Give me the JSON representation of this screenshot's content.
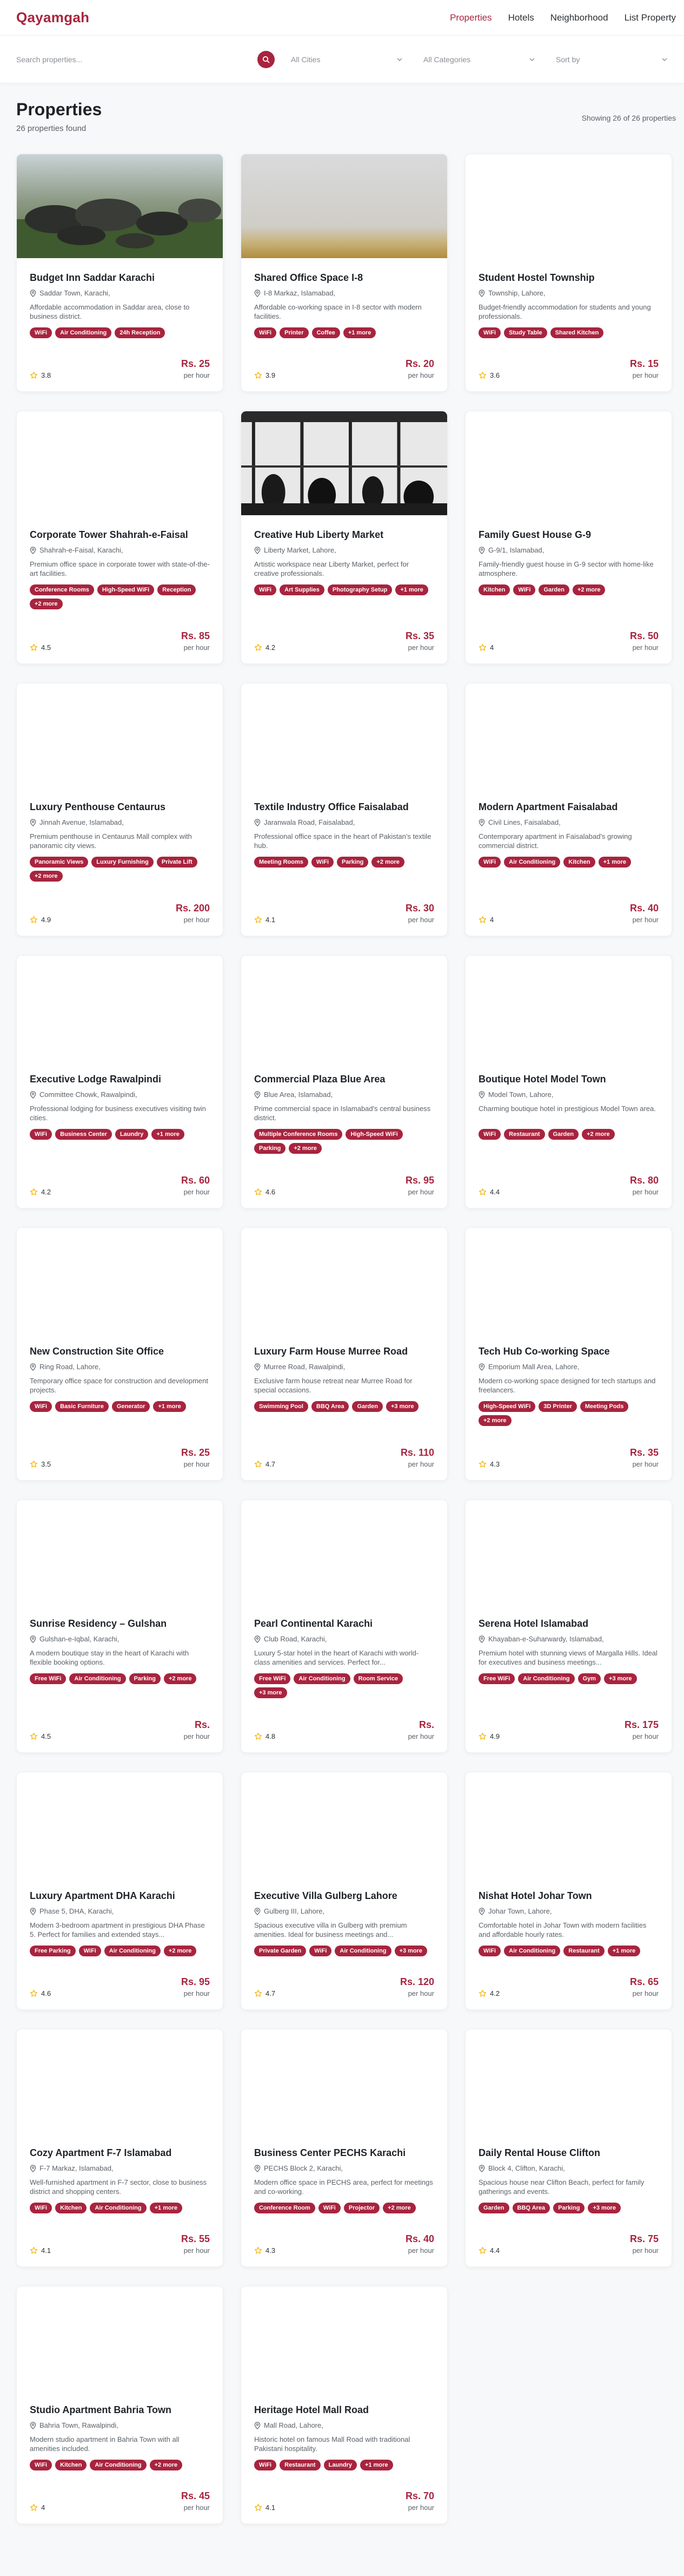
{
  "brand": "Qayamgah",
  "nav": [
    {
      "label": "Properties",
      "active": true
    },
    {
      "label": "Hotels",
      "active": false
    },
    {
      "label": "Neighborhood",
      "active": false
    },
    {
      "label": "List Property",
      "active": false
    }
  ],
  "filters": {
    "search_placeholder": "Search properties...",
    "cities": "All Cities",
    "categories": "All Categories",
    "sort": "Sort by"
  },
  "page": {
    "title": "Properties",
    "count": "26 properties found",
    "showing": "Showing 26 of 26 properties"
  },
  "colors": {
    "accent": "#a8243e",
    "star": "#f4b400"
  },
  "properties": [
    {
      "title": "Budget Inn Saddar Karachi",
      "location": "Saddar Town, Karachi,",
      "description": "Affordable accommodation in Saddar area, close to business district.",
      "tags": [
        "WiFi",
        "Air Conditioning",
        "24h Reception"
      ],
      "rating": "3.8",
      "price": "Rs. 25",
      "unit": "per hour",
      "image": "rocks"
    },
    {
      "title": "Shared Office Space I-8",
      "location": "I-8 Markaz, Islamabad,",
      "description": "Affordable co-working space in I-8 sector with modern facilities.",
      "tags": [
        "WiFi",
        "Printer",
        "Coffee",
        "+1 more"
      ],
      "rating": "3.9",
      "price": "Rs. 20",
      "unit": "per hour",
      "image": "fog"
    },
    {
      "title": "Student Hostel Township",
      "location": "Township, Lahore,",
      "description": "Budget-friendly accommodation for students and young professionals.",
      "tags": [
        "WiFi",
        "Study Table",
        "Shared Kitchen"
      ],
      "rating": "3.6",
      "price": "Rs. 15",
      "unit": "per hour",
      "image": "none"
    },
    {
      "title": "Corporate Tower Shahrah-e-Faisal",
      "location": "Shahrah-e-Faisal, Karachi,",
      "description": "Premium office space in corporate tower with state-of-the-art facilities.",
      "tags": [
        "Conference Rooms",
        "High-Speed WiFi",
        "Reception",
        "+2 more"
      ],
      "rating": "4.5",
      "price": "Rs. 85",
      "unit": "per hour",
      "image": "none"
    },
    {
      "title": "Creative Hub Liberty Market",
      "location": "Liberty Market, Lahore,",
      "description": "Artistic workspace near Liberty Market, perfect for creative professionals.",
      "tags": [
        "WiFi",
        "Art Supplies",
        "Photography Setup",
        "+1 more"
      ],
      "rating": "4.2",
      "price": "Rs. 35",
      "unit": "per hour",
      "image": "cafe"
    },
    {
      "title": "Family Guest House G-9",
      "location": "G-9/1, Islamabad,",
      "description": "Family-friendly guest house in G-9 sector with home-like atmosphere.",
      "tags": [
        "Kitchen",
        "WiFi",
        "Garden",
        "+2 more"
      ],
      "rating": "4",
      "price": "Rs. 50",
      "unit": "per hour",
      "image": "none"
    },
    {
      "title": "Luxury Penthouse Centaurus",
      "location": "Jinnah Avenue, Islamabad,",
      "description": "Premium penthouse in Centaurus Mall complex with panoramic city views.",
      "tags": [
        "Panoramic Views",
        "Luxury Furnishing",
        "Private Lift",
        "+2 more"
      ],
      "rating": "4.9",
      "price": "Rs. 200",
      "unit": "per hour",
      "image": "none"
    },
    {
      "title": "Textile Industry Office Faisalabad",
      "location": "Jaranwala Road, Faisalabad,",
      "description": "Professional office space in the heart of Pakistan's textile hub.",
      "tags": [
        "Meeting Rooms",
        "WiFi",
        "Parking",
        "+2 more"
      ],
      "rating": "4.1",
      "price": "Rs. 30",
      "unit": "per hour",
      "image": "none"
    },
    {
      "title": "Modern Apartment Faisalabad",
      "location": "Civil Lines, Faisalabad,",
      "description": "Contemporary apartment in Faisalabad's growing commercial district.",
      "tags": [
        "WiFi",
        "Air Conditioning",
        "Kitchen",
        "+1 more"
      ],
      "rating": "4",
      "price": "Rs. 40",
      "unit": "per hour",
      "image": "none"
    },
    {
      "title": "Executive Lodge Rawalpindi",
      "location": "Committee Chowk, Rawalpindi,",
      "description": "Professional lodging for business executives visiting twin cities.",
      "tags": [
        "WiFi",
        "Business Center",
        "Laundry",
        "+1 more"
      ],
      "rating": "4.2",
      "price": "Rs. 60",
      "unit": "per hour",
      "image": "none"
    },
    {
      "title": "Commercial Plaza Blue Area",
      "location": "Blue Area, Islamabad,",
      "description": "Prime commercial space in Islamabad's central business district.",
      "tags": [
        "Multiple Conference Rooms",
        "High-Speed WiFi",
        "Parking",
        "+2 more"
      ],
      "rating": "4.6",
      "price": "Rs. 95",
      "unit": "per hour",
      "image": "none"
    },
    {
      "title": "Boutique Hotel Model Town",
      "location": "Model Town, Lahore,",
      "description": "Charming boutique hotel in prestigious Model Town area.",
      "tags": [
        "WiFi",
        "Restaurant",
        "Garden",
        "+2 more"
      ],
      "rating": "4.4",
      "price": "Rs. 80",
      "unit": "per hour",
      "image": "none"
    },
    {
      "title": "New Construction Site Office",
      "location": "Ring Road, Lahore,",
      "description": "Temporary office space for construction and development projects.",
      "tags": [
        "WiFi",
        "Basic Furniture",
        "Generator",
        "+1 more"
      ],
      "rating": "3.5",
      "price": "Rs. 25",
      "unit": "per hour",
      "image": "none"
    },
    {
      "title": "Luxury Farm House Murree Road",
      "location": "Murree Road, Rawalpindi,",
      "description": "Exclusive farm house retreat near Murree Road for special occasions.",
      "tags": [
        "Swimming Pool",
        "BBQ Area",
        "Garden",
        "+3 more"
      ],
      "rating": "4.7",
      "price": "Rs. 110",
      "unit": "per hour",
      "image": "none"
    },
    {
      "title": "Tech Hub Co-working Space",
      "location": "Emporium Mall Area, Lahore,",
      "description": "Modern co-working space designed for tech startups and freelancers.",
      "tags": [
        "High-Speed WiFi",
        "3D Printer",
        "Meeting Pods",
        "+2 more"
      ],
      "rating": "4.3",
      "price": "Rs. 35",
      "unit": "per hour",
      "image": "none"
    },
    {
      "title": "Sunrise Residency – Gulshan",
      "location": "Gulshan-e-Iqbal, Karachi,",
      "description": "A modern boutique stay in the heart of Karachi with flexible booking options.",
      "tags": [
        "Free WiFi",
        "Air Conditioning",
        "Parking",
        "+2 more"
      ],
      "rating": "4.5",
      "price": "Rs.",
      "unit": "per hour",
      "image": "none"
    },
    {
      "title": "Pearl Continental Karachi",
      "location": "Club Road, Karachi,",
      "description": "Luxury 5-star hotel in the heart of Karachi with world-class amenities and services. Perfect for...",
      "tags": [
        "Free WiFi",
        "Air Conditioning",
        "Room Service",
        "+3 more"
      ],
      "rating": "4.8",
      "price": "Rs.",
      "unit": "per hour",
      "image": "none"
    },
    {
      "title": "Serena Hotel Islamabad",
      "location": "Khayaban-e-Suharwardy, Islamabad,",
      "description": "Premium hotel with stunning views of Margalla Hills. Ideal for executives and business meetings...",
      "tags": [
        "Free WiFi",
        "Air Conditioning",
        "Gym",
        "+3 more"
      ],
      "rating": "4.9",
      "price": "Rs. 175",
      "unit": "per hour",
      "image": "none"
    },
    {
      "title": "Luxury Apartment DHA Karachi",
      "location": "Phase 5, DHA, Karachi,",
      "description": "Modern 3-bedroom apartment in prestigious DHA Phase 5. Perfect for families and extended stays...",
      "tags": [
        "Free Parking",
        "WiFi",
        "Air Conditioning",
        "+2 more"
      ],
      "rating": "4.6",
      "price": "Rs. 95",
      "unit": "per hour",
      "image": "none"
    },
    {
      "title": "Executive Villa Gulberg Lahore",
      "location": "Gulberg III, Lahore,",
      "description": "Spacious executive villa in Gulberg with premium amenities. Ideal for business meetings and...",
      "tags": [
        "Private Garden",
        "WiFi",
        "Air Conditioning",
        "+3 more"
      ],
      "rating": "4.7",
      "price": "Rs. 120",
      "unit": "per hour",
      "image": "none"
    },
    {
      "title": "Nishat Hotel Johar Town",
      "location": "Johar Town, Lahore,",
      "description": "Comfortable hotel in Johar Town with modern facilities and affordable hourly rates.",
      "tags": [
        "WiFi",
        "Air Conditioning",
        "Restaurant",
        "+1 more"
      ],
      "rating": "4.2",
      "price": "Rs. 65",
      "unit": "per hour",
      "image": "none"
    },
    {
      "title": "Cozy Apartment F-7 Islamabad",
      "location": "F-7 Markaz, Islamabad,",
      "description": "Well-furnished apartment in F-7 sector, close to business district and shopping centers.",
      "tags": [
        "WiFi",
        "Kitchen",
        "Air Conditioning",
        "+1 more"
      ],
      "rating": "4.1",
      "price": "Rs. 55",
      "unit": "per hour",
      "image": "none"
    },
    {
      "title": "Business Center PECHS Karachi",
      "location": "PECHS Block 2, Karachi,",
      "description": "Modern office space in PECHS area, perfect for meetings and co-working.",
      "tags": [
        "Conference Room",
        "WiFi",
        "Projector",
        "+2 more"
      ],
      "rating": "4.3",
      "price": "Rs. 40",
      "unit": "per hour",
      "image": "none"
    },
    {
      "title": "Daily Rental House Clifton",
      "location": "Block 4, Clifton, Karachi,",
      "description": "Spacious house near Clifton Beach, perfect for family gatherings and events.",
      "tags": [
        "Garden",
        "BBQ Area",
        "Parking",
        "+3 more"
      ],
      "rating": "4.4",
      "price": "Rs. 75",
      "unit": "per hour",
      "image": "none"
    },
    {
      "title": "Studio Apartment Bahria Town",
      "location": "Bahria Town, Rawalpindi,",
      "description": "Modern studio apartment in Bahria Town with all amenities included.",
      "tags": [
        "WiFi",
        "Kitchen",
        "Air Conditioning",
        "+2 more"
      ],
      "rating": "4",
      "price": "Rs. 45",
      "unit": "per hour",
      "image": "none"
    },
    {
      "title": "Heritage Hotel Mall Road",
      "location": "Mall Road, Lahore,",
      "description": "Historic hotel on famous Mall Road with traditional Pakistani hospitality.",
      "tags": [
        "WiFi",
        "Restaurant",
        "Laundry",
        "+1 more"
      ],
      "rating": "4.1",
      "price": "Rs. 70",
      "unit": "per hour",
      "image": "none"
    }
  ]
}
